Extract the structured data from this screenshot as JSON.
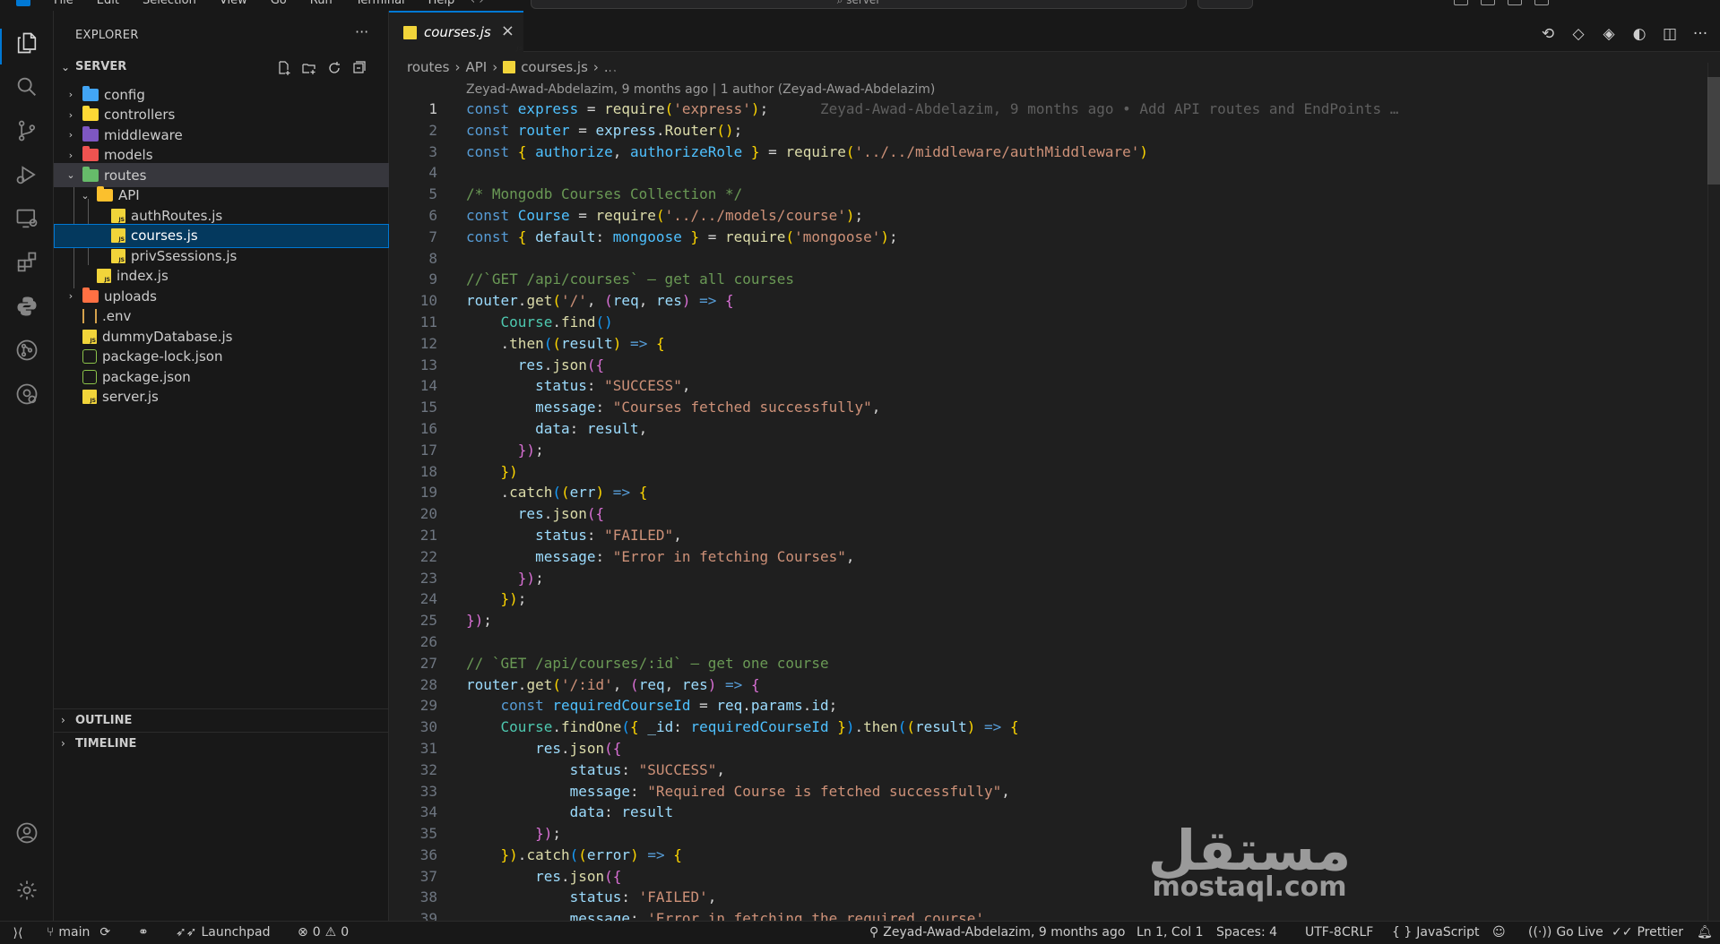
{
  "titlebar": {
    "menu": [
      "File",
      "Edit",
      "Selection",
      "View",
      "Go",
      "Run",
      "Terminal",
      "Help"
    ],
    "command_center": "server"
  },
  "sidebar": {
    "title": "EXPLORER",
    "section": "SERVER",
    "tree": [
      {
        "label": "config",
        "type": "folder",
        "depth": 0,
        "expanded": false,
        "color": "#42a5f5"
      },
      {
        "label": "controllers",
        "type": "folder",
        "depth": 0,
        "expanded": false,
        "color": "#fdd835"
      },
      {
        "label": "middleware",
        "type": "folder",
        "depth": 0,
        "expanded": false,
        "color": "#7e57c2"
      },
      {
        "label": "models",
        "type": "folder",
        "depth": 0,
        "expanded": false,
        "color": "#ef5350"
      },
      {
        "label": "routes",
        "type": "folder",
        "depth": 0,
        "expanded": true,
        "color": "#66bb6a"
      },
      {
        "label": "API",
        "type": "folder",
        "depth": 1,
        "expanded": true,
        "color": "#fbc02d"
      },
      {
        "label": "authRoutes.js",
        "type": "js",
        "depth": 2
      },
      {
        "label": "courses.js",
        "type": "js",
        "depth": 2,
        "selected": true
      },
      {
        "label": "privSsessions.js",
        "type": "js",
        "depth": 2
      },
      {
        "label": "index.js",
        "type": "js",
        "depth": 1
      },
      {
        "label": "uploads",
        "type": "folder",
        "depth": 0,
        "expanded": false,
        "color": "#ff7043"
      },
      {
        "label": ".env",
        "type": "env",
        "depth": 0
      },
      {
        "label": "dummyDatabase.js",
        "type": "js",
        "depth": 0
      },
      {
        "label": "package-lock.json",
        "type": "json",
        "depth": 0
      },
      {
        "label": "package.json",
        "type": "json",
        "depth": 0
      },
      {
        "label": "server.js",
        "type": "js",
        "depth": 0
      }
    ],
    "outline_label": "OUTLINE",
    "timeline_label": "TIMELINE"
  },
  "editor": {
    "tab_label": "courses.js",
    "breadcrumb": [
      "routes",
      "API",
      "courses.js",
      "..."
    ],
    "blame_header": "Zeyad-Awad-Abdelazim, 9 months ago | 1 author (Zeyad-Awad-Abdelazim)",
    "inline_blame": "Zeyad-Awad-Abdelazim, 9 months ago • Add API routes and EndPoints …",
    "active_line": 1,
    "lines": [
      [
        [
          "kw",
          "const "
        ],
        [
          "cst",
          "express"
        ],
        [
          "pun",
          " = "
        ],
        [
          "fn",
          "require"
        ],
        [
          "b1",
          "("
        ],
        [
          "str",
          "'express'"
        ],
        [
          "b1",
          ")"
        ],
        [
          "pun",
          ";"
        ]
      ],
      [
        [
          "kw",
          "const "
        ],
        [
          "cst",
          "router"
        ],
        [
          "pun",
          " = "
        ],
        [
          "var",
          "express"
        ],
        [
          "pun",
          "."
        ],
        [
          "fn",
          "Router"
        ],
        [
          "b1",
          "()"
        ],
        [
          "pun",
          ";"
        ]
      ],
      [
        [
          "kw",
          "const "
        ],
        [
          "b1",
          "{ "
        ],
        [
          "cst",
          "authorize"
        ],
        [
          "pun",
          ", "
        ],
        [
          "cst",
          "authorizeRole"
        ],
        [
          "b1",
          " }"
        ],
        [
          "pun",
          " = "
        ],
        [
          "fn",
          "require"
        ],
        [
          "b1",
          "("
        ],
        [
          "str",
          "'../../middleware/authMiddleware'"
        ],
        [
          "b1",
          ")"
        ]
      ],
      [],
      [
        [
          "cmt",
          "/* Mongodb Courses Collection */"
        ]
      ],
      [
        [
          "kw",
          "const "
        ],
        [
          "cst",
          "Course"
        ],
        [
          "pun",
          " = "
        ],
        [
          "fn",
          "require"
        ],
        [
          "b1",
          "("
        ],
        [
          "str",
          "'../../models/course'"
        ],
        [
          "b1",
          ")"
        ],
        [
          "pun",
          ";"
        ]
      ],
      [
        [
          "kw",
          "const "
        ],
        [
          "b1",
          "{ "
        ],
        [
          "var",
          "default"
        ],
        [
          "pun",
          ": "
        ],
        [
          "cst",
          "mongoose"
        ],
        [
          "b1",
          " }"
        ],
        [
          "pun",
          " = "
        ],
        [
          "fn",
          "require"
        ],
        [
          "b1",
          "("
        ],
        [
          "str",
          "'mongoose'"
        ],
        [
          "b1",
          ")"
        ],
        [
          "pun",
          ";"
        ]
      ],
      [],
      [
        [
          "cmt",
          "//`GET /api/courses` — get all courses"
        ]
      ],
      [
        [
          "var",
          "router"
        ],
        [
          "pun",
          "."
        ],
        [
          "fn",
          "get"
        ],
        [
          "b1",
          "("
        ],
        [
          "str",
          "'/'"
        ],
        [
          "pun",
          ", "
        ],
        [
          "b2",
          "("
        ],
        [
          "var",
          "req"
        ],
        [
          "pun",
          ", "
        ],
        [
          "var",
          "res"
        ],
        [
          "b2",
          ")"
        ],
        [
          "kw",
          " => "
        ],
        [
          "b2",
          "{"
        ]
      ],
      [
        [
          "pun",
          "    "
        ],
        [
          "cls",
          "Course"
        ],
        [
          "pun",
          "."
        ],
        [
          "fn",
          "find"
        ],
        [
          "b3",
          "()"
        ]
      ],
      [
        [
          "pun",
          "    ."
        ],
        [
          "fn",
          "then"
        ],
        [
          "b3",
          "("
        ],
        [
          "b1",
          "("
        ],
        [
          "var",
          "result"
        ],
        [
          "b1",
          ")"
        ],
        [
          "kw",
          " => "
        ],
        [
          "b1",
          "{"
        ]
      ],
      [
        [
          "pun",
          "      "
        ],
        [
          "var",
          "res"
        ],
        [
          "pun",
          "."
        ],
        [
          "fn",
          "json"
        ],
        [
          "b2",
          "({"
        ]
      ],
      [
        [
          "pun",
          "        "
        ],
        [
          "var",
          "status"
        ],
        [
          "pun",
          ": "
        ],
        [
          "str",
          "\"SUCCESS\""
        ],
        [
          "pun",
          ","
        ]
      ],
      [
        [
          "pun",
          "        "
        ],
        [
          "var",
          "message"
        ],
        [
          "pun",
          ": "
        ],
        [
          "str",
          "\"Courses fetched successfully\""
        ],
        [
          "pun",
          ","
        ]
      ],
      [
        [
          "pun",
          "        "
        ],
        [
          "var",
          "data"
        ],
        [
          "pun",
          ": "
        ],
        [
          "var",
          "result"
        ],
        [
          "pun",
          ","
        ]
      ],
      [
        [
          "pun",
          "      "
        ],
        [
          "b2",
          "})"
        ],
        [
          "pun",
          ";"
        ]
      ],
      [
        [
          "pun",
          "    "
        ],
        [
          "b1",
          "})"
        ]
      ],
      [
        [
          "pun",
          "    ."
        ],
        [
          "fn",
          "catch"
        ],
        [
          "b3",
          "("
        ],
        [
          "b1",
          "("
        ],
        [
          "var",
          "err"
        ],
        [
          "b1",
          ")"
        ],
        [
          "kw",
          " => "
        ],
        [
          "b1",
          "{"
        ]
      ],
      [
        [
          "pun",
          "      "
        ],
        [
          "var",
          "res"
        ],
        [
          "pun",
          "."
        ],
        [
          "fn",
          "json"
        ],
        [
          "b2",
          "({"
        ]
      ],
      [
        [
          "pun",
          "        "
        ],
        [
          "var",
          "status"
        ],
        [
          "pun",
          ": "
        ],
        [
          "str",
          "\"FAILED\""
        ],
        [
          "pun",
          ","
        ]
      ],
      [
        [
          "pun",
          "        "
        ],
        [
          "var",
          "message"
        ],
        [
          "pun",
          ": "
        ],
        [
          "str",
          "\"Error in fetching Courses\""
        ],
        [
          "pun",
          ","
        ]
      ],
      [
        [
          "pun",
          "      "
        ],
        [
          "b2",
          "})"
        ],
        [
          "pun",
          ";"
        ]
      ],
      [
        [
          "pun",
          "    "
        ],
        [
          "b1",
          "})"
        ],
        [
          "pun",
          ";"
        ]
      ],
      [
        [
          "b2",
          "})"
        ],
        [
          "pun",
          ";"
        ]
      ],
      [],
      [
        [
          "cmt",
          "// `GET /api/courses/:id` — get one course"
        ]
      ],
      [
        [
          "var",
          "router"
        ],
        [
          "pun",
          "."
        ],
        [
          "fn",
          "get"
        ],
        [
          "b1",
          "("
        ],
        [
          "str",
          "'/:id'"
        ],
        [
          "pun",
          ", "
        ],
        [
          "b2",
          "("
        ],
        [
          "var",
          "req"
        ],
        [
          "pun",
          ", "
        ],
        [
          "var",
          "res"
        ],
        [
          "b2",
          ")"
        ],
        [
          "kw",
          " => "
        ],
        [
          "b2",
          "{"
        ]
      ],
      [
        [
          "pun",
          "    "
        ],
        [
          "kw",
          "const "
        ],
        [
          "cst",
          "requiredCourseId"
        ],
        [
          "pun",
          " = "
        ],
        [
          "var",
          "req"
        ],
        [
          "pun",
          "."
        ],
        [
          "var",
          "params"
        ],
        [
          "pun",
          "."
        ],
        [
          "var",
          "id"
        ],
        [
          "pun",
          ";"
        ]
      ],
      [
        [
          "pun",
          "    "
        ],
        [
          "cls",
          "Course"
        ],
        [
          "pun",
          "."
        ],
        [
          "fn",
          "findOne"
        ],
        [
          "b3",
          "("
        ],
        [
          "b1",
          "{ "
        ],
        [
          "var",
          "_id"
        ],
        [
          "pun",
          ": "
        ],
        [
          "cst",
          "requiredCourseId"
        ],
        [
          "b1",
          " }"
        ],
        [
          "b3",
          ")"
        ],
        [
          "pun",
          "."
        ],
        [
          "fn",
          "then"
        ],
        [
          "b3",
          "("
        ],
        [
          "b1",
          "("
        ],
        [
          "var",
          "result"
        ],
        [
          "b1",
          ")"
        ],
        [
          "kw",
          " => "
        ],
        [
          "b1",
          "{"
        ]
      ],
      [
        [
          "pun",
          "        "
        ],
        [
          "var",
          "res"
        ],
        [
          "pun",
          "."
        ],
        [
          "fn",
          "json"
        ],
        [
          "b2",
          "({"
        ]
      ],
      [
        [
          "pun",
          "            "
        ],
        [
          "var",
          "status"
        ],
        [
          "pun",
          ": "
        ],
        [
          "str",
          "\"SUCCESS\""
        ],
        [
          "pun",
          ","
        ]
      ],
      [
        [
          "pun",
          "            "
        ],
        [
          "var",
          "message"
        ],
        [
          "pun",
          ": "
        ],
        [
          "str",
          "\"Required Course is fetched successfully\""
        ],
        [
          "pun",
          ","
        ]
      ],
      [
        [
          "pun",
          "            "
        ],
        [
          "var",
          "data"
        ],
        [
          "pun",
          ": "
        ],
        [
          "var",
          "result"
        ]
      ],
      [
        [
          "pun",
          "        "
        ],
        [
          "b2",
          "})"
        ],
        [
          "pun",
          ";"
        ]
      ],
      [
        [
          "pun",
          "    "
        ],
        [
          "b1",
          "})"
        ],
        [
          "pun",
          "."
        ],
        [
          "fn",
          "catch"
        ],
        [
          "b3",
          "("
        ],
        [
          "b1",
          "("
        ],
        [
          "var",
          "error"
        ],
        [
          "b1",
          ")"
        ],
        [
          "kw",
          " => "
        ],
        [
          "b1",
          "{"
        ]
      ],
      [
        [
          "pun",
          "        "
        ],
        [
          "var",
          "res"
        ],
        [
          "pun",
          "."
        ],
        [
          "fn",
          "json"
        ],
        [
          "b2",
          "({"
        ]
      ],
      [
        [
          "pun",
          "            "
        ],
        [
          "var",
          "status"
        ],
        [
          "pun",
          ": "
        ],
        [
          "str",
          "'FAILED'"
        ],
        [
          "pun",
          ","
        ]
      ],
      [
        [
          "pun",
          "            "
        ],
        [
          "var",
          "message"
        ],
        [
          "pun",
          ": "
        ],
        [
          "str",
          "'Error in fetching the required course'"
        ]
      ]
    ]
  },
  "watermark": {
    "arabic": "مستقل",
    "latin": "mostaql.com"
  },
  "statusbar": {
    "branch": "main",
    "launchpad": "Launchpad",
    "errors": "0",
    "warnings": "0",
    "blame": "Zeyad-Awad-Abdelazim, 9 months ago",
    "position": "Ln 1, Col 1",
    "spaces": "Spaces: 4",
    "encoding": "UTF-8",
    "eol": "CRLF",
    "language": "JavaScript",
    "golive": "Go Live",
    "prettier": "Prettier"
  }
}
